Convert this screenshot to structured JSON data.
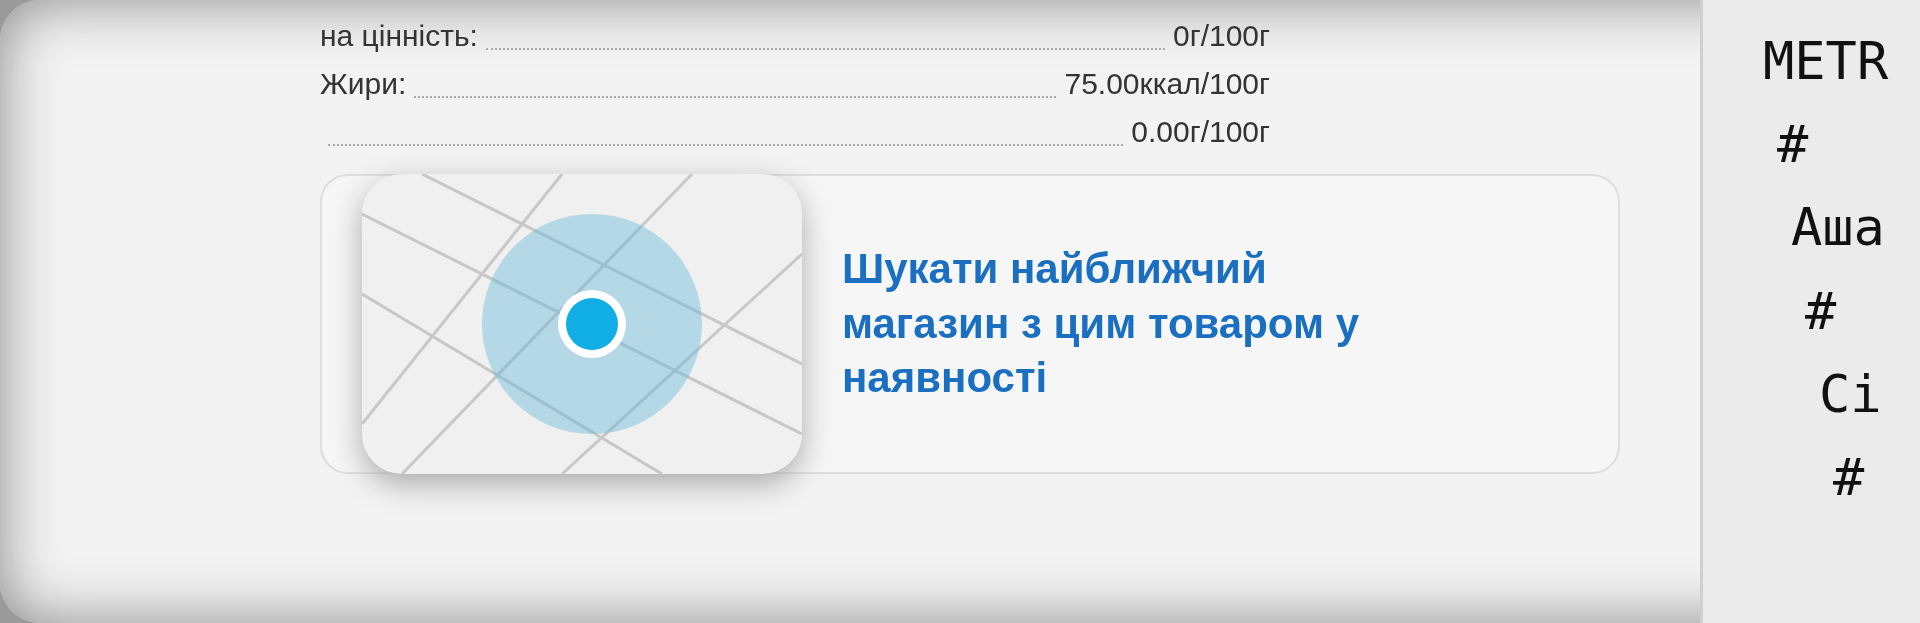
{
  "nutrition": [
    {
      "label": "на цінність:",
      "value": "0г/100г"
    },
    {
      "label": "Жири:",
      "value": "75.00ккал/100г"
    },
    {
      "value": "0.00г/100г"
    }
  ],
  "store_finder": {
    "link": "Шукати найближчий магазин з цим товаром у наявності"
  },
  "receipt": {
    "lines": [
      "METR",
      "#",
      "Аша",
      "#",
      "Сі",
      "#"
    ]
  }
}
